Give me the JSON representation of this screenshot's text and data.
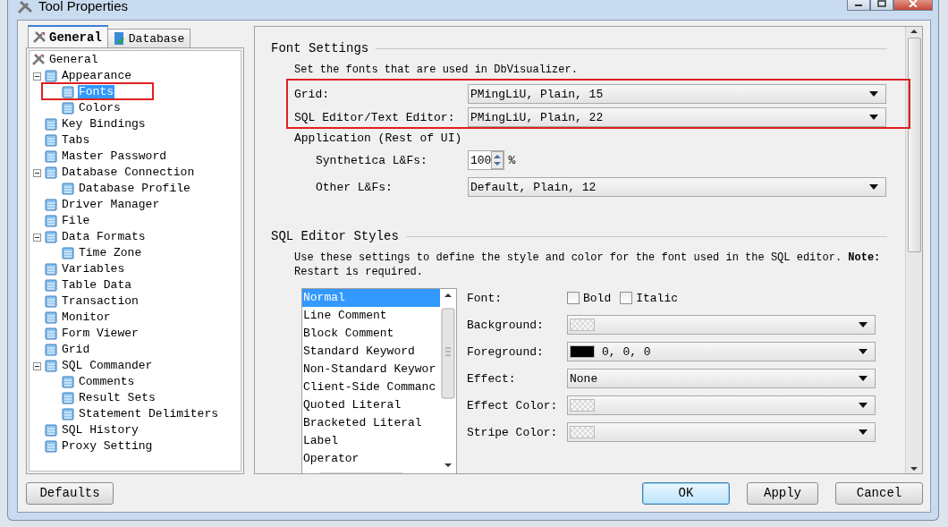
{
  "window": {
    "title": "Tool Properties"
  },
  "tabs": [
    {
      "label": "General",
      "selected": true
    },
    {
      "label": "Database",
      "selected": false
    }
  ],
  "tree": {
    "label": "General",
    "selected": false,
    "children": [
      {
        "label": "Appearance",
        "selected": false,
        "expanded": true,
        "children": [
          {
            "label": "Fonts",
            "selected": true
          },
          {
            "label": "Colors",
            "selected": false
          }
        ]
      },
      {
        "label": "Key Bindings",
        "selected": false
      },
      {
        "label": "Tabs",
        "selected": false
      },
      {
        "label": "Master Password",
        "selected": false
      },
      {
        "label": "Database Connection",
        "selected": false,
        "expanded": true,
        "children": [
          {
            "label": "Database Profile",
            "selected": false
          }
        ]
      },
      {
        "label": "Driver Manager",
        "selected": false
      },
      {
        "label": "File",
        "selected": false
      },
      {
        "label": "Data Formats",
        "selected": false,
        "expanded": true,
        "children": [
          {
            "label": "Time Zone",
            "selected": false
          }
        ]
      },
      {
        "label": "Variables",
        "selected": false
      },
      {
        "label": "Table Data",
        "selected": false
      },
      {
        "label": "Transaction",
        "selected": false
      },
      {
        "label": "Monitor",
        "selected": false
      },
      {
        "label": "Form Viewer",
        "selected": false
      },
      {
        "label": "Grid",
        "selected": false
      },
      {
        "label": "SQL Commander",
        "selected": false,
        "expanded": true,
        "children": [
          {
            "label": "Comments",
            "selected": false
          },
          {
            "label": "Result Sets",
            "selected": false
          },
          {
            "label": "Statement Delimiters",
            "selected": false
          }
        ]
      },
      {
        "label": "SQL History",
        "selected": false
      },
      {
        "label": "Proxy Setting",
        "selected": false
      }
    ]
  },
  "font_settings": {
    "title": "Font Settings",
    "description": "Set the fonts that are used in DbVisualizer.",
    "fields": [
      {
        "label": "Grid:",
        "value": "PMingLiU, Plain, 15"
      },
      {
        "label": "SQL Editor/Text Editor:",
        "value": "PMingLiU, Plain, 22"
      }
    ],
    "application": {
      "label": "Application (Rest of UI)",
      "synthetica": {
        "label": "Synthetica L&Fs:",
        "value": "100",
        "unit": "%"
      },
      "other": {
        "label": "Other L&Fs:",
        "value": "Default, Plain, 12"
      }
    }
  },
  "sql_editor_styles": {
    "title": "SQL Editor Styles",
    "description": "Use these settings to define the style and color for the font used in the SQL editor. **Note:** Restart is required.",
    "styles": [
      {
        "label": "Normal",
        "selected": true
      },
      {
        "label": "Line Comment",
        "selected": false
      },
      {
        "label": "Block Comment",
        "selected": false
      },
      {
        "label": "Standard Keyword",
        "selected": false
      },
      {
        "label": "Non-Standard Keywor",
        "selected": false
      },
      {
        "label": "Client-Side Commanc",
        "selected": false
      },
      {
        "label": "Quoted Literal",
        "selected": false
      },
      {
        "label": "Bracketed Literal",
        "selected": false
      },
      {
        "label": "Label",
        "selected": false
      },
      {
        "label": "Operator",
        "selected": false
      }
    ],
    "font": {
      "label": "Font:",
      "options": [
        {
          "label": "Bold",
          "checked": false
        },
        {
          "label": "Italic",
          "checked": false
        }
      ]
    },
    "properties": [
      {
        "label": "Background:",
        "kind": "color"
      },
      {
        "label": "Foreground:",
        "kind": "color",
        "color": "#000000",
        "value": "0, 0, 0"
      },
      {
        "label": "Effect:",
        "kind": "choice",
        "value": "None"
      },
      {
        "label": "Effect Color:",
        "kind": "color"
      },
      {
        "label": "Stripe Color:",
        "kind": "color"
      }
    ]
  },
  "buttons": {
    "left": [
      {
        "label": "Defaults",
        "default": false
      }
    ],
    "right": [
      {
        "label": "OK",
        "default": true
      },
      {
        "label": "Apply",
        "default": false
      },
      {
        "label": "Cancel",
        "default": false
      }
    ]
  }
}
